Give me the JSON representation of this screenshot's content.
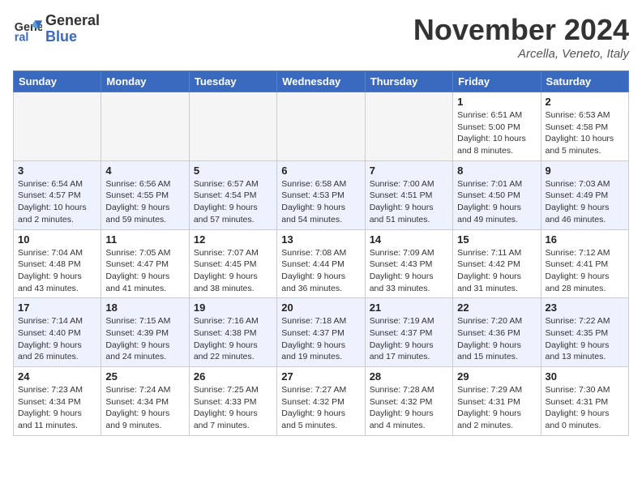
{
  "header": {
    "logo_general": "General",
    "logo_blue": "Blue",
    "month_title": "November 2024",
    "location": "Arcella, Veneto, Italy"
  },
  "weekdays": [
    "Sunday",
    "Monday",
    "Tuesday",
    "Wednesday",
    "Thursday",
    "Friday",
    "Saturday"
  ],
  "weeks": [
    [
      {
        "day": "",
        "info": ""
      },
      {
        "day": "",
        "info": ""
      },
      {
        "day": "",
        "info": ""
      },
      {
        "day": "",
        "info": ""
      },
      {
        "day": "",
        "info": ""
      },
      {
        "day": "1",
        "info": "Sunrise: 6:51 AM\nSunset: 5:00 PM\nDaylight: 10 hours and 8 minutes."
      },
      {
        "day": "2",
        "info": "Sunrise: 6:53 AM\nSunset: 4:58 PM\nDaylight: 10 hours and 5 minutes."
      }
    ],
    [
      {
        "day": "3",
        "info": "Sunrise: 6:54 AM\nSunset: 4:57 PM\nDaylight: 10 hours and 2 minutes."
      },
      {
        "day": "4",
        "info": "Sunrise: 6:56 AM\nSunset: 4:55 PM\nDaylight: 9 hours and 59 minutes."
      },
      {
        "day": "5",
        "info": "Sunrise: 6:57 AM\nSunset: 4:54 PM\nDaylight: 9 hours and 57 minutes."
      },
      {
        "day": "6",
        "info": "Sunrise: 6:58 AM\nSunset: 4:53 PM\nDaylight: 9 hours and 54 minutes."
      },
      {
        "day": "7",
        "info": "Sunrise: 7:00 AM\nSunset: 4:51 PM\nDaylight: 9 hours and 51 minutes."
      },
      {
        "day": "8",
        "info": "Sunrise: 7:01 AM\nSunset: 4:50 PM\nDaylight: 9 hours and 49 minutes."
      },
      {
        "day": "9",
        "info": "Sunrise: 7:03 AM\nSunset: 4:49 PM\nDaylight: 9 hours and 46 minutes."
      }
    ],
    [
      {
        "day": "10",
        "info": "Sunrise: 7:04 AM\nSunset: 4:48 PM\nDaylight: 9 hours and 43 minutes."
      },
      {
        "day": "11",
        "info": "Sunrise: 7:05 AM\nSunset: 4:47 PM\nDaylight: 9 hours and 41 minutes."
      },
      {
        "day": "12",
        "info": "Sunrise: 7:07 AM\nSunset: 4:45 PM\nDaylight: 9 hours and 38 minutes."
      },
      {
        "day": "13",
        "info": "Sunrise: 7:08 AM\nSunset: 4:44 PM\nDaylight: 9 hours and 36 minutes."
      },
      {
        "day": "14",
        "info": "Sunrise: 7:09 AM\nSunset: 4:43 PM\nDaylight: 9 hours and 33 minutes."
      },
      {
        "day": "15",
        "info": "Sunrise: 7:11 AM\nSunset: 4:42 PM\nDaylight: 9 hours and 31 minutes."
      },
      {
        "day": "16",
        "info": "Sunrise: 7:12 AM\nSunset: 4:41 PM\nDaylight: 9 hours and 28 minutes."
      }
    ],
    [
      {
        "day": "17",
        "info": "Sunrise: 7:14 AM\nSunset: 4:40 PM\nDaylight: 9 hours and 26 minutes."
      },
      {
        "day": "18",
        "info": "Sunrise: 7:15 AM\nSunset: 4:39 PM\nDaylight: 9 hours and 24 minutes."
      },
      {
        "day": "19",
        "info": "Sunrise: 7:16 AM\nSunset: 4:38 PM\nDaylight: 9 hours and 22 minutes."
      },
      {
        "day": "20",
        "info": "Sunrise: 7:18 AM\nSunset: 4:37 PM\nDaylight: 9 hours and 19 minutes."
      },
      {
        "day": "21",
        "info": "Sunrise: 7:19 AM\nSunset: 4:37 PM\nDaylight: 9 hours and 17 minutes."
      },
      {
        "day": "22",
        "info": "Sunrise: 7:20 AM\nSunset: 4:36 PM\nDaylight: 9 hours and 15 minutes."
      },
      {
        "day": "23",
        "info": "Sunrise: 7:22 AM\nSunset: 4:35 PM\nDaylight: 9 hours and 13 minutes."
      }
    ],
    [
      {
        "day": "24",
        "info": "Sunrise: 7:23 AM\nSunset: 4:34 PM\nDaylight: 9 hours and 11 minutes."
      },
      {
        "day": "25",
        "info": "Sunrise: 7:24 AM\nSunset: 4:34 PM\nDaylight: 9 hours and 9 minutes."
      },
      {
        "day": "26",
        "info": "Sunrise: 7:25 AM\nSunset: 4:33 PM\nDaylight: 9 hours and 7 minutes."
      },
      {
        "day": "27",
        "info": "Sunrise: 7:27 AM\nSunset: 4:32 PM\nDaylight: 9 hours and 5 minutes."
      },
      {
        "day": "28",
        "info": "Sunrise: 7:28 AM\nSunset: 4:32 PM\nDaylight: 9 hours and 4 minutes."
      },
      {
        "day": "29",
        "info": "Sunrise: 7:29 AM\nSunset: 4:31 PM\nDaylight: 9 hours and 2 minutes."
      },
      {
        "day": "30",
        "info": "Sunrise: 7:30 AM\nSunset: 4:31 PM\nDaylight: 9 hours and 0 minutes."
      }
    ]
  ]
}
